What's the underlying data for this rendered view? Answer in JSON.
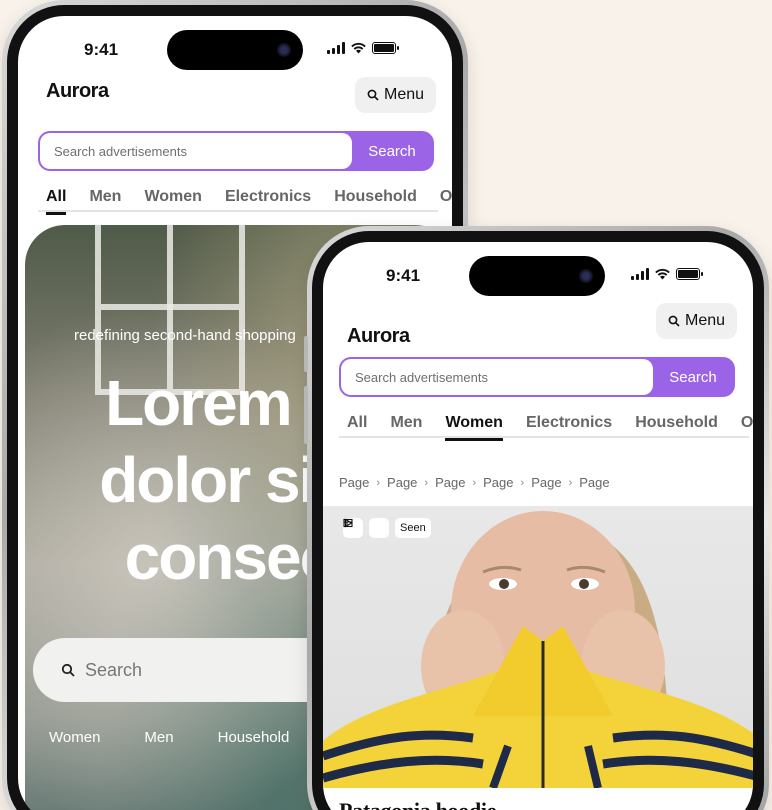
{
  "back_phone": {
    "status": {
      "time": "9:41"
    },
    "header": {
      "logo": "Aurora",
      "menu_label": "Menu"
    },
    "search": {
      "placeholder": "Search advertisements",
      "button_label": "Search"
    },
    "tabs": [
      {
        "label": "All",
        "active": true
      },
      {
        "label": "Men",
        "active": false
      },
      {
        "label": "Women",
        "active": false
      },
      {
        "label": "Electronics",
        "active": false
      },
      {
        "label": "Household",
        "active": false
      },
      {
        "label": "O",
        "active": false
      }
    ],
    "hero": {
      "tagline": "redefining second-hand shopping",
      "title_lines": [
        "Lorem ipsum",
        "dolor sit amet",
        "consectetur"
      ],
      "search_placeholder": "Search",
      "categories": [
        "Women",
        "Men",
        "Household"
      ]
    }
  },
  "front_phone": {
    "status": {
      "time": "9:41"
    },
    "header": {
      "logo": "Aurora",
      "menu_label": "Menu"
    },
    "search": {
      "placeholder": "Search advertisements",
      "button_label": "Search"
    },
    "tabs": [
      {
        "label": "All",
        "active": false
      },
      {
        "label": "Men",
        "active": false
      },
      {
        "label": "Women",
        "active": true
      },
      {
        "label": "Electronics",
        "active": false
      },
      {
        "label": "Household",
        "active": false
      },
      {
        "label": "O",
        "active": false
      }
    ],
    "breadcrumb": [
      "Page",
      "Page",
      "Page",
      "Page",
      "Page",
      "Page"
    ],
    "product": {
      "seen_label": "Seen",
      "title": "Patagonia hoodie"
    }
  },
  "colors": {
    "accent": "#9b63e6",
    "background": "#f8f2ea",
    "hoodie_yellow": "#f3d23a",
    "stripe_navy": "#1f2a48"
  }
}
